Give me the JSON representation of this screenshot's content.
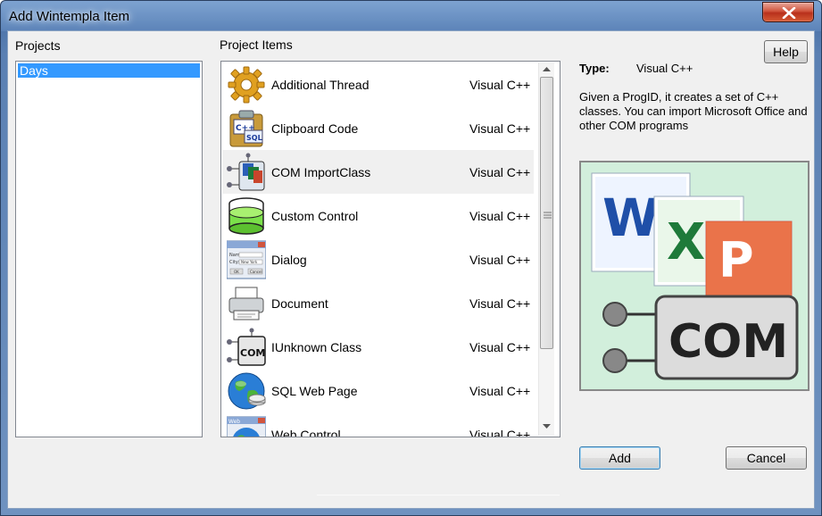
{
  "window": {
    "title": "Add Wintempla Item"
  },
  "projects": {
    "heading": "Projects",
    "items": [
      {
        "label": "Days"
      }
    ]
  },
  "project_items": {
    "heading": "Project Items",
    "items": [
      {
        "name": "Additional Thread",
        "type": "Visual C++",
        "icon": "gear-icon"
      },
      {
        "name": "Clipboard Code",
        "type": "Visual C++",
        "icon": "clipboard-icon"
      },
      {
        "name": "COM ImportClass",
        "type": "Visual C++",
        "icon": "com-import-icon"
      },
      {
        "name": "Custom Control",
        "type": "Visual C++",
        "icon": "cylinder-icon"
      },
      {
        "name": "Dialog",
        "type": "Visual C++",
        "icon": "dialog-icon"
      },
      {
        "name": "Document",
        "type": "Visual C++",
        "icon": "printer-icon"
      },
      {
        "name": "IUnknown Class",
        "type": "Visual C++",
        "icon": "com-icon"
      },
      {
        "name": "SQL Web Page",
        "type": "Visual C++",
        "icon": "globe-icon"
      },
      {
        "name": "Web Control",
        "type": "Visual C++",
        "icon": "web-globe-icon"
      }
    ]
  },
  "details": {
    "type_label": "Type:",
    "type_value": "Visual C++",
    "description": "Given a ProgID, it creates a set of C++ classes.  You can import Microsoft Office and other COM programs",
    "preview_word": "COM",
    "icon_letters": {
      "word": "W",
      "excel": "X",
      "powerpoint": "P",
      "clipboard_top": "C++",
      "clipboard_bottom": "SQL",
      "com": "COM",
      "web": "Web"
    },
    "dialog_fields": {
      "name": "Name:",
      "city": "City:",
      "city_value": "New York",
      "ok": "OK",
      "cancel": "Cancel"
    }
  },
  "buttons": {
    "help": "Help",
    "add": "Add",
    "cancel": "Cancel"
  },
  "colors": {
    "selection": "#3399ff",
    "title_gradient_top": "#7ea3d1",
    "close_red": "#c8452c"
  }
}
